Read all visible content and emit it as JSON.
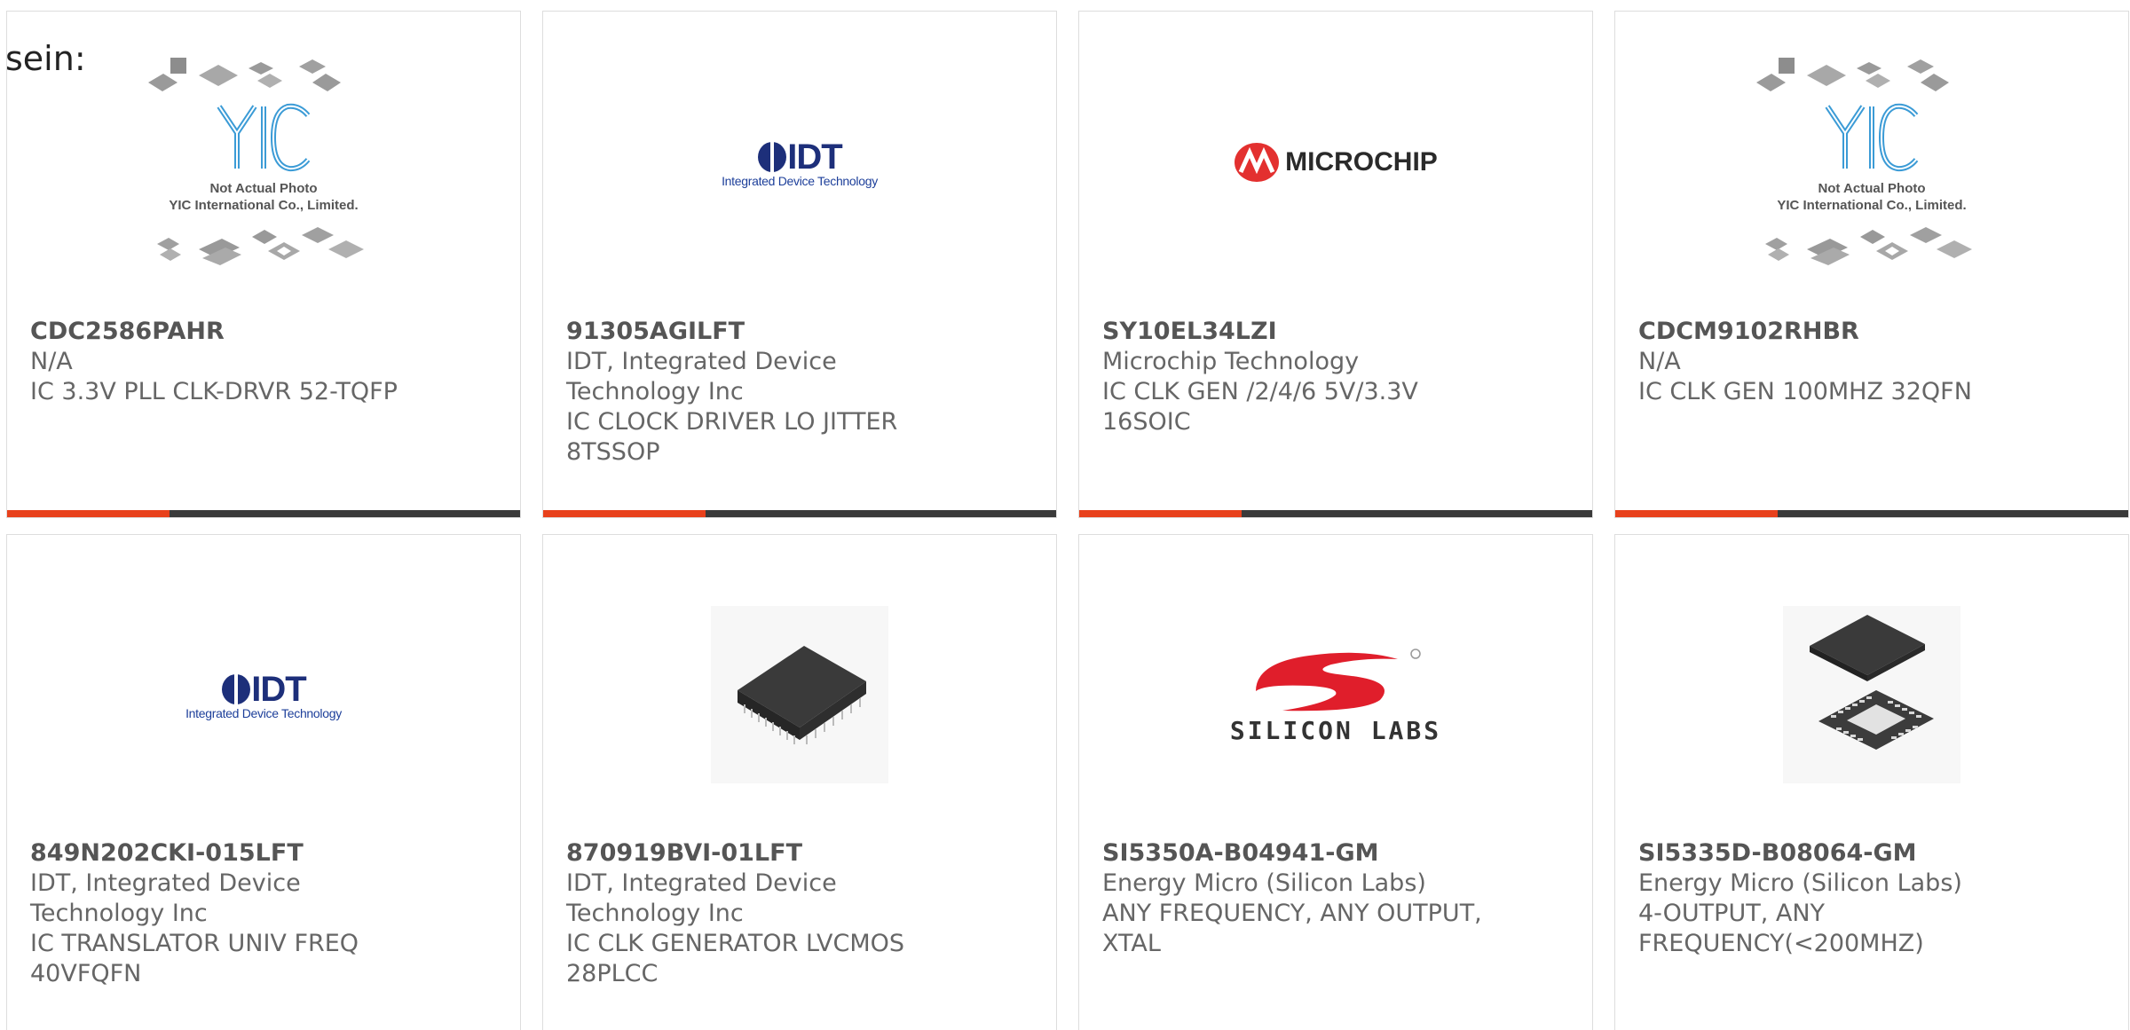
{
  "prefix_text": "sein:",
  "colors": {
    "accent": "#e8411c",
    "bar": "#3a3a3a",
    "border": "#dddddd"
  },
  "placeholder": {
    "line1": "Not Actual Photo",
    "line2": "YIC International Co., Limited."
  },
  "logos": {
    "idt_word": "IDT",
    "idt_sub": "Integrated Device Technology",
    "microchip_word": "MICROCHIP",
    "silabs_word": "SILICON LABS"
  },
  "products": [
    {
      "part": "CDC2586PAHR",
      "manufacturer": "N/A",
      "description": "IC 3.3V PLL CLK-DRVR 52-TQFP",
      "image": "yic-placeholder"
    },
    {
      "part": "91305AGILFT",
      "manufacturer": "IDT, Integrated Device Technology Inc",
      "description": "IC CLOCK DRIVER LO JITTER 8TSSOP",
      "image": "idt-logo"
    },
    {
      "part": "SY10EL34LZI",
      "manufacturer": "Microchip Technology",
      "description": "IC CLK GEN /2/4/6 5V/3.3V 16SOIC",
      "image": "microchip-logo"
    },
    {
      "part": "CDCM9102RHBR",
      "manufacturer": "N/A",
      "description": "IC CLK GEN 100MHZ 32QFN",
      "image": "yic-placeholder"
    },
    {
      "part": "849N202CKI-015LFT",
      "manufacturer": "IDT, Integrated Device Technology Inc",
      "description": "IC TRANSLATOR UNIV FREQ 40VFQFN",
      "image": "idt-logo"
    },
    {
      "part": "870919BVI-01LFT",
      "manufacturer": "IDT, Integrated Device Technology Inc",
      "description": "IC CLK GENERATOR LVCMOS 28PLCC",
      "image": "plcc-chip-photo"
    },
    {
      "part": "SI5350A-B04941-GM",
      "manufacturer": "Energy Micro (Silicon Labs)",
      "description": "ANY FREQUENCY, ANY OUTPUT, XTAL",
      "image": "silicon-labs-logo"
    },
    {
      "part": "SI5335D-B08064-GM",
      "manufacturer": "Energy Micro (Silicon Labs)",
      "description": "4-OUTPUT, ANY FREQUENCY(<200MHZ)",
      "image": "qfn-chip-photo"
    }
  ]
}
